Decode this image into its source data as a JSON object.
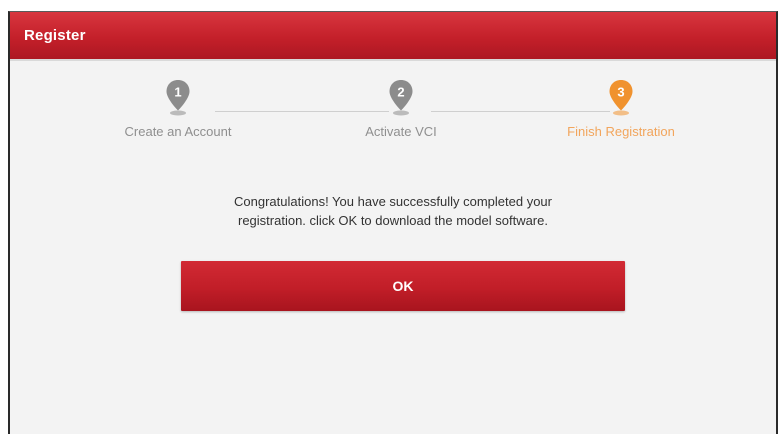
{
  "header": {
    "title": "Register"
  },
  "steps": [
    {
      "number": "1",
      "label": "Create an Account",
      "state": "completed"
    },
    {
      "number": "2",
      "label": "Activate VCI",
      "state": "completed"
    },
    {
      "number": "3",
      "label": "Finish Registration",
      "state": "active"
    }
  ],
  "message": {
    "line1": "Congratulations! You have successfully completed your",
    "line2": "registration. click OK to download the model software."
  },
  "actions": {
    "ok_label": "OK"
  },
  "colors": {
    "brand_red": "#c4202a",
    "active_step": "#f0922e",
    "inactive_step": "#8c8c8c",
    "background": "#f3f3f3"
  },
  "icons": {
    "step_marker": "map-pin-icon"
  }
}
